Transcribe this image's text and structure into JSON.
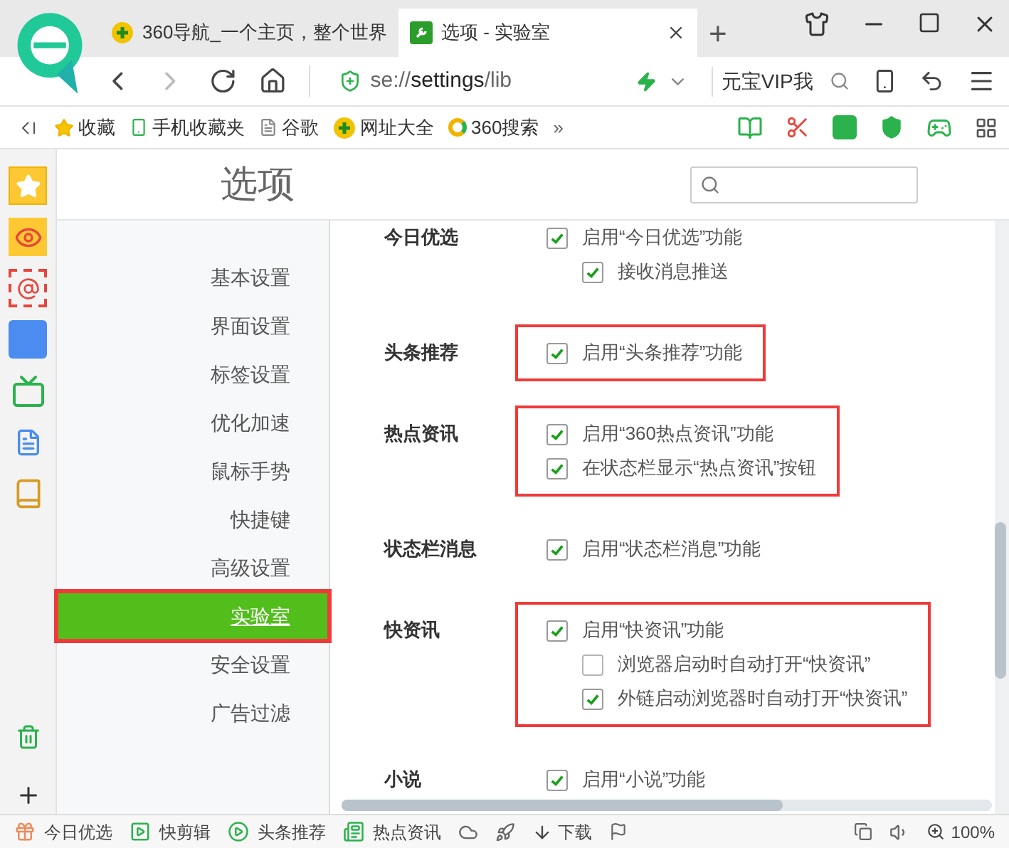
{
  "tabs": [
    {
      "title": "360导航_一个主页，整个世界",
      "selected": false
    },
    {
      "title": "选项 - 实验室",
      "selected": true
    }
  ],
  "new_tab": "+",
  "address": {
    "scheme": "se://",
    "host": "settings",
    "path": "/lib"
  },
  "search": {
    "value": "元宝VIP我"
  },
  "bookmarks": [
    "收藏",
    "手机收藏夹",
    "谷歌",
    "网址大全",
    "360搜索"
  ],
  "bookmarks_more": "»",
  "page_title": "选项",
  "nav": [
    {
      "label": "基本设置",
      "selected": false,
      "highlighted": false
    },
    {
      "label": "界面设置",
      "selected": false,
      "highlighted": false
    },
    {
      "label": "标签设置",
      "selected": false,
      "highlighted": false
    },
    {
      "label": "优化加速",
      "selected": false,
      "highlighted": false
    },
    {
      "label": "鼠标手势",
      "selected": false,
      "highlighted": false
    },
    {
      "label": "快捷键",
      "selected": false,
      "highlighted": false
    },
    {
      "label": "高级设置",
      "selected": false,
      "highlighted": false
    },
    {
      "label": "实验室",
      "selected": true,
      "highlighted": true
    },
    {
      "label": "安全设置",
      "selected": false,
      "highlighted": false
    },
    {
      "label": "广告过滤",
      "selected": false,
      "highlighted": false
    }
  ],
  "sections": [
    {
      "title": "今日优选",
      "highlighted": false,
      "options": [
        {
          "label": "启用“今日优选”功能",
          "checked": true,
          "children": [
            {
              "label": "接收消息推送",
              "checked": true
            }
          ]
        }
      ]
    },
    {
      "title": "头条推荐",
      "highlighted": true,
      "options": [
        {
          "label": "启用“头条推荐”功能",
          "checked": true
        }
      ]
    },
    {
      "title": "热点资讯",
      "highlighted": true,
      "options": [
        {
          "label": "启用“360热点资讯”功能",
          "checked": true
        },
        {
          "label": "在状态栏显示“热点资讯”按钮",
          "checked": true
        }
      ]
    },
    {
      "title": "状态栏消息",
      "highlighted": false,
      "options": [
        {
          "label": "启用“状态栏消息”功能",
          "checked": true
        }
      ]
    },
    {
      "title": "快资讯",
      "highlighted": true,
      "options": [
        {
          "label": "启用“快资讯”功能",
          "checked": true,
          "children": [
            {
              "label": "浏览器启动时自动打开“快资讯”",
              "checked": false
            },
            {
              "label": "外链启动浏览器时自动打开“快资讯”",
              "checked": true
            }
          ]
        }
      ]
    },
    {
      "title": "小说",
      "highlighted": false,
      "options": [
        {
          "label": "启用“小说”功能",
          "checked": true
        }
      ]
    }
  ],
  "status_bar": {
    "items": [
      "今日优选",
      "快剪辑",
      "头条推荐",
      "热点资讯"
    ],
    "download": "下载",
    "zoom": "100%"
  }
}
